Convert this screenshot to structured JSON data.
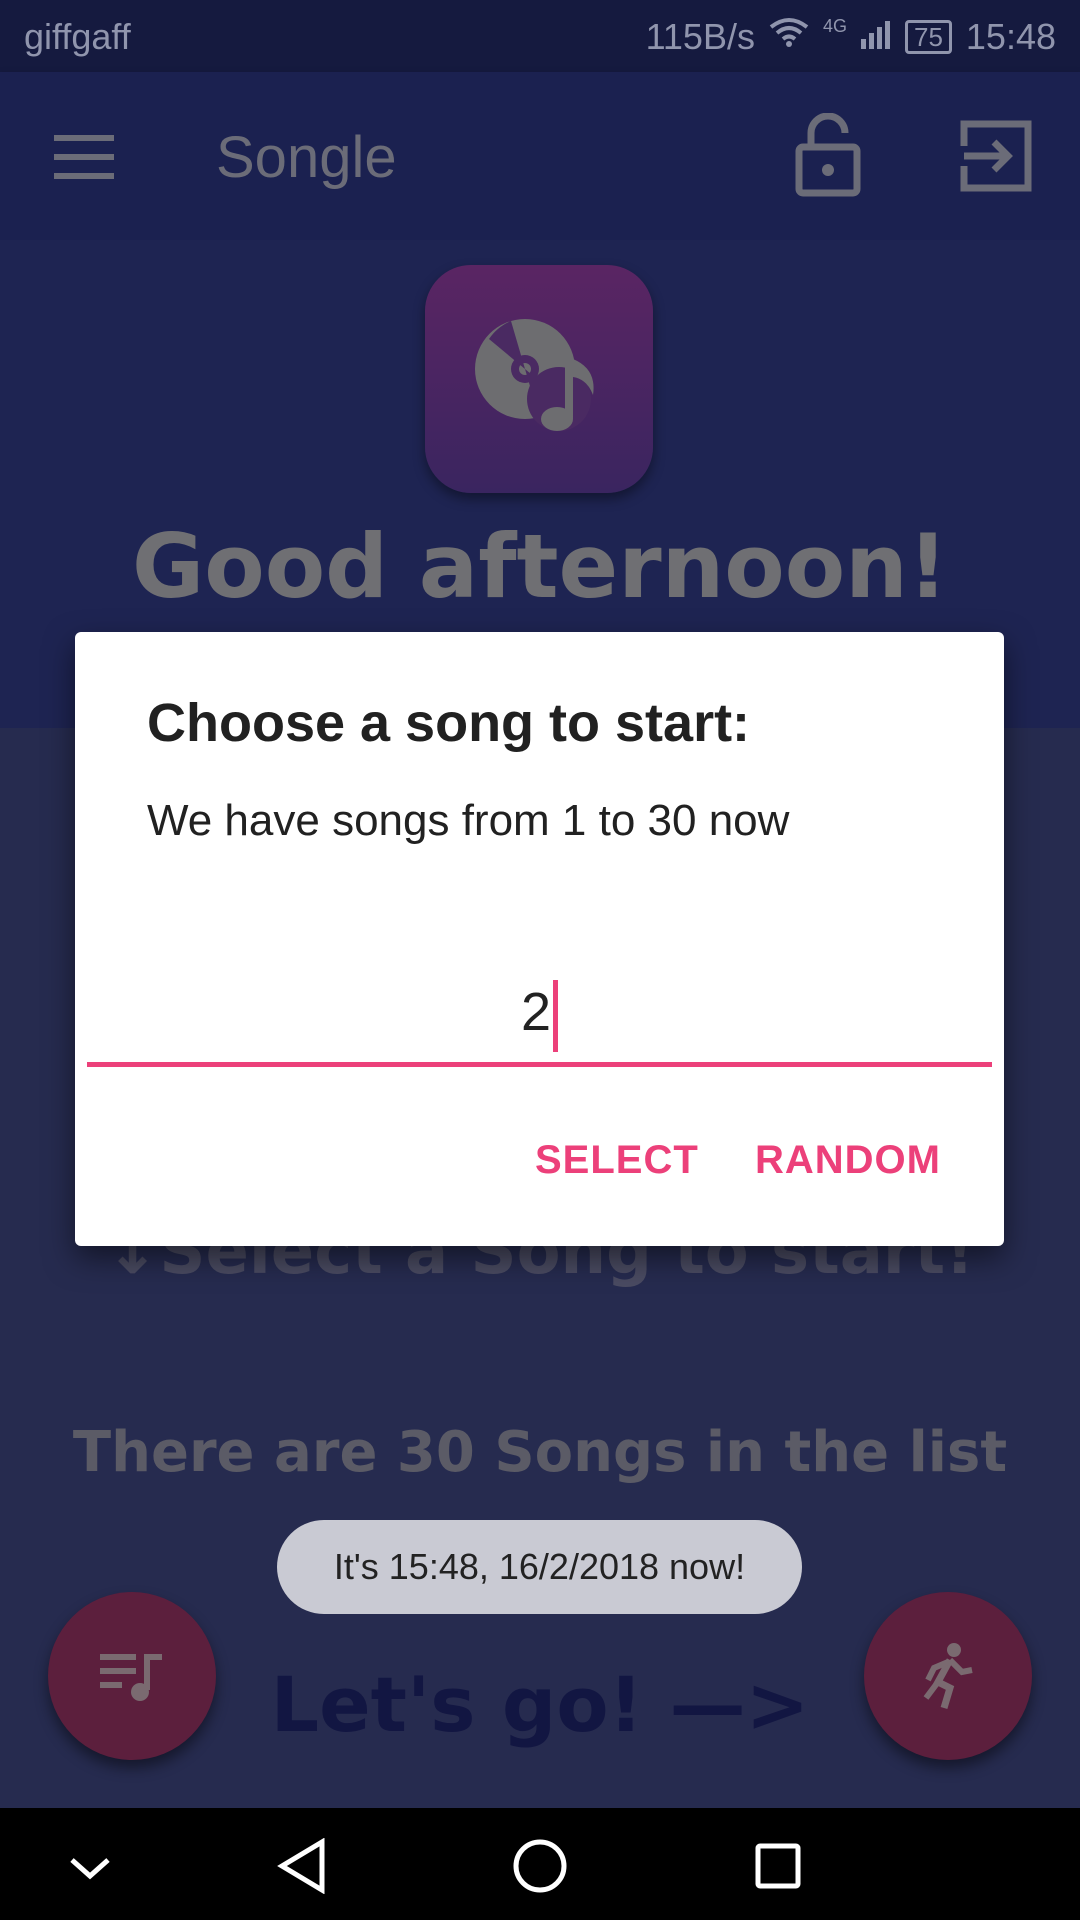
{
  "status_bar": {
    "carrier": "giffgaff",
    "net_speed": "115B/s",
    "network": "4G",
    "battery": "75",
    "time": "15:48"
  },
  "app_bar": {
    "title": "Songle"
  },
  "main": {
    "greeting": "Good afternoon!",
    "select_hint": "↓Select a Song to start!",
    "song_count_text": "There are 30 Songs in the list",
    "lets_go": "Let's go! —>"
  },
  "dialog": {
    "title": "Choose a song to start:",
    "message": "We have songs from 1 to 30 now",
    "input_value": "2",
    "select_label": "SELECT",
    "random_label": "RANDOM"
  },
  "toast": {
    "text": "It's 15:48, 16/2/2018 now!"
  },
  "colors": {
    "accent": "#ec407a",
    "app_bar": "#1b2150",
    "fab": "#5c1f3d"
  }
}
